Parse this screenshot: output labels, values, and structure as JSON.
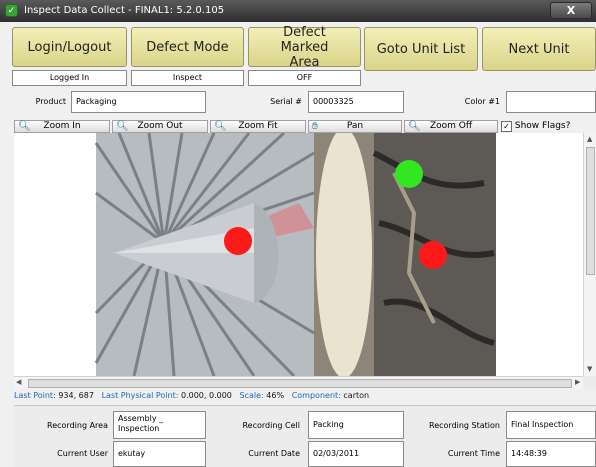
{
  "window": {
    "title": "Inspect Data Collect - FINAL1: 5.2.0.105",
    "close_label": "X"
  },
  "buttons": {
    "login_logout": "Login/Logout",
    "defect_mode": "Defect Mode",
    "defect_marked_area": "Defect Marked Area",
    "goto_unit_list": "Goto Unit List",
    "next_unit": "Next Unit"
  },
  "status": {
    "login": "Logged In",
    "mode": "Inspect",
    "marked_area": "OFF"
  },
  "fields": {
    "product_label": "Product",
    "product_value": "Packaging",
    "serial_label": "Serial #",
    "serial_value": "00003325",
    "color_label": "Color #1",
    "color_value": ""
  },
  "zoom_toolbar": {
    "zoom_in": "Zoom In",
    "zoom_out": "Zoom Out",
    "zoom_fit": "Zoom Fit",
    "pan": "Pan",
    "zoom_off": "Zoom Off",
    "show_flags": "Show Flags?",
    "show_flags_checked": true
  },
  "markers": [
    {
      "color": "#ff1a1a"
    },
    {
      "color": "#33e622"
    },
    {
      "color": "#ff1a1a"
    }
  ],
  "status_bar": {
    "last_point_label": "Last Point:",
    "last_point_value": "934,  687",
    "last_physical_label": "Last Physical Point:",
    "last_physical_value": "0.000, 0.000",
    "scale_label": "Scale:",
    "scale_value": "46%",
    "component_label": "Component:",
    "component_value": "carton"
  },
  "bottom": {
    "recording_area_label": "Recording Area",
    "recording_area_value": "Assembly _ Inspection",
    "recording_cell_label": "Recording Cell",
    "recording_cell_value": "Packing",
    "recording_station_label": "Recording Station",
    "recording_station_value": "Final Inspection",
    "current_user_label": "Current User",
    "current_user_value": "ekutay",
    "current_date_label": "Current Date",
    "current_date_value": "02/03/2011",
    "current_time_label": "Current Time",
    "current_time_value": "14:48:39"
  },
  "colors": {
    "button_face": "#ece7a6",
    "titlebar": "#3c3c3c",
    "status_text": "#1a3aa0"
  }
}
